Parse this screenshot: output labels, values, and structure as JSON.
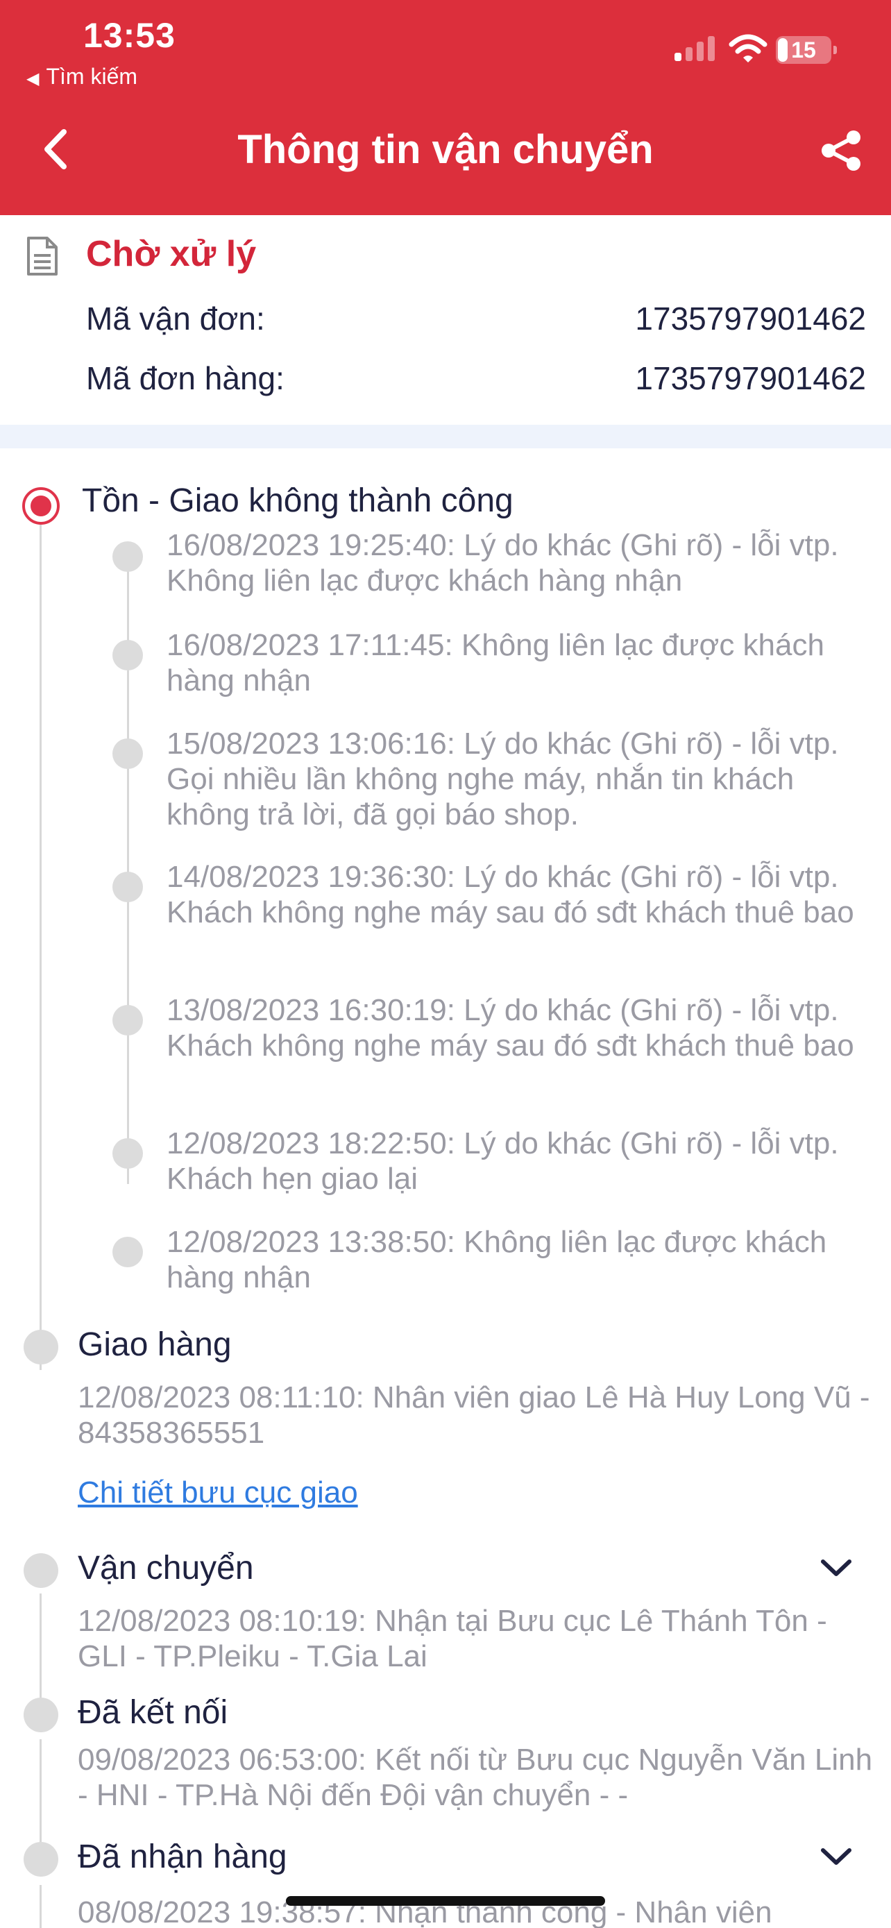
{
  "status_bar": {
    "time": "13:53",
    "back_label": "Tìm kiếm",
    "battery": "15"
  },
  "nav": {
    "title": "Thông tin vận chuyển",
    "back_icon": "chevron-left-icon",
    "share_icon": "share-icon"
  },
  "summary": {
    "status": "Chờ xử lý",
    "waybill_label": "Mã vận đơn:",
    "waybill_value": "1735797901462",
    "order_label": "Mã đơn hàng:",
    "order_value": "1735797901462"
  },
  "timeline": {
    "current": {
      "title": "Tồn - Giao không thành công",
      "events": [
        "16/08/2023 19:25:40: Lý do khác (Ghi rõ) - lỗi vtp. Không liên lạc được khách hàng nhận",
        "16/08/2023 17:11:45: Không liên lạc được khách hàng nhận",
        "15/08/2023 13:06:16: Lý do khác (Ghi rõ) - lỗi vtp. Gọi nhiều lần không nghe máy, nhắn tin khách không trả lời, đã gọi báo shop.",
        "14/08/2023 19:36:30: Lý do khác (Ghi rõ) - lỗi vtp. Khách không nghe máy sau đó sđt khách thuê bao",
        "13/08/2023 16:30:19: Lý do khác (Ghi rõ) - lỗi vtp. Khách không nghe máy sau đó sđt khách thuê bao",
        "12/08/2023 18:22:50: Lý do khác (Ghi rõ) - lỗi vtp. Khách hẹn giao lại",
        "12/08/2023 13:38:50: Không liên lạc được khách hàng nhận"
      ]
    },
    "delivery": {
      "title": "Giao hàng",
      "event": "12/08/2023 08:11:10: Nhân viên giao Lê Hà Huy Long Vũ - 84358365551",
      "link": "Chi tiết bưu cục giao"
    },
    "transport": {
      "title": "Vận chuyển",
      "event": "12/08/2023 08:10:19: Nhận tại Bưu cục Lê Thánh Tôn - GLI - TP.Pleiku - T.Gia Lai"
    },
    "connected": {
      "title": "Đã kết nối",
      "event": "09/08/2023 06:53:00: Kết nối từ Bưu cục Nguyễn Văn Linh - HNI - TP.Hà Nội đến Đội vận chuyển -  -"
    },
    "received": {
      "title": "Đã nhận hàng",
      "event": "08/08/2023 19:38:57: Nhận thành công - Nhân viên"
    }
  },
  "colors": {
    "brand_red": "#dc2f3c",
    "status_red": "#d3263a",
    "link_blue": "#2f7be0",
    "muted_text": "#9a9aa3"
  }
}
